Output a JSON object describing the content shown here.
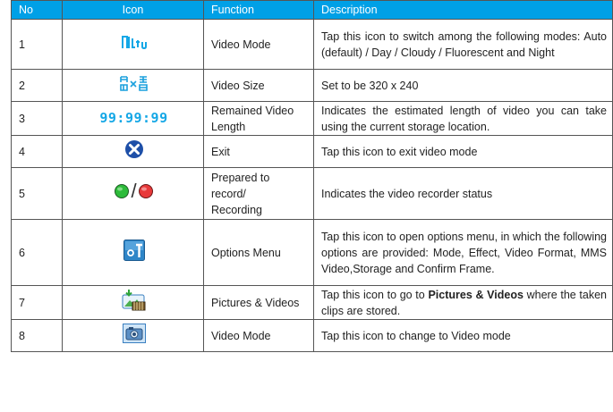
{
  "headers": {
    "no": "No",
    "icon": "Icon",
    "function": "Function",
    "description": "Description"
  },
  "rows": [
    {
      "no": "1",
      "icon_name": "video-mode-light-icon",
      "function": "Video Mode",
      "description": "Tap this icon to switch among the following modes: Auto (default) / Day / Cloudy / Fluorescent and Night"
    },
    {
      "no": "2",
      "icon_name": "video-size-icon",
      "icon_text": "",
      "function": "Set to be 320 x 240",
      "function_is_desc": true,
      "function_label": "Video Size"
    },
    {
      "no": "3",
      "icon_name": "remaining-length-digits-icon",
      "icon_text": "99:99:99",
      "function": "Remained Video Length",
      "description": "Indicates the estimated length of video you can take using the current storage location."
    },
    {
      "no": "4",
      "icon_name": "exit-icon",
      "function": "Exit",
      "description": "Tap this icon to exit video mode"
    },
    {
      "no": "5",
      "icon_name": "recorder-status-icon",
      "icon_sep": "/",
      "function": "Prepared to record/ Recording",
      "function_part1": "Prepared to",
      "function_part2": "record/",
      "function_part3": "Recording",
      "description": "Indicates the video recorder status"
    },
    {
      "no": "6",
      "icon_name": "options-menu-icon",
      "function": "Options Menu",
      "description": "Tap this icon to open options menu, in which the following options are provided: Mode, Effect, Video Format, MMS Video,Storage and Confirm Frame."
    },
    {
      "no": "7",
      "icon_name": "pictures-videos-icon",
      "function": "Pictures & Videos",
      "description_pre": "Tap this icon to go to ",
      "description_bold": "Pictures & Videos",
      "description_post": " where the taken clips are stored."
    },
    {
      "no": "8",
      "icon_name": "camera-switch-icon",
      "function": "Video Mode",
      "description": "Tap this icon to change to Video mode"
    }
  ],
  "colors": {
    "header_bg": "#00a0e6",
    "icon_blue": "#14a7e6",
    "green_dot": "#2dbb3a",
    "red_dot": "#e8393a",
    "exit_blue": "#1e4fa8"
  }
}
